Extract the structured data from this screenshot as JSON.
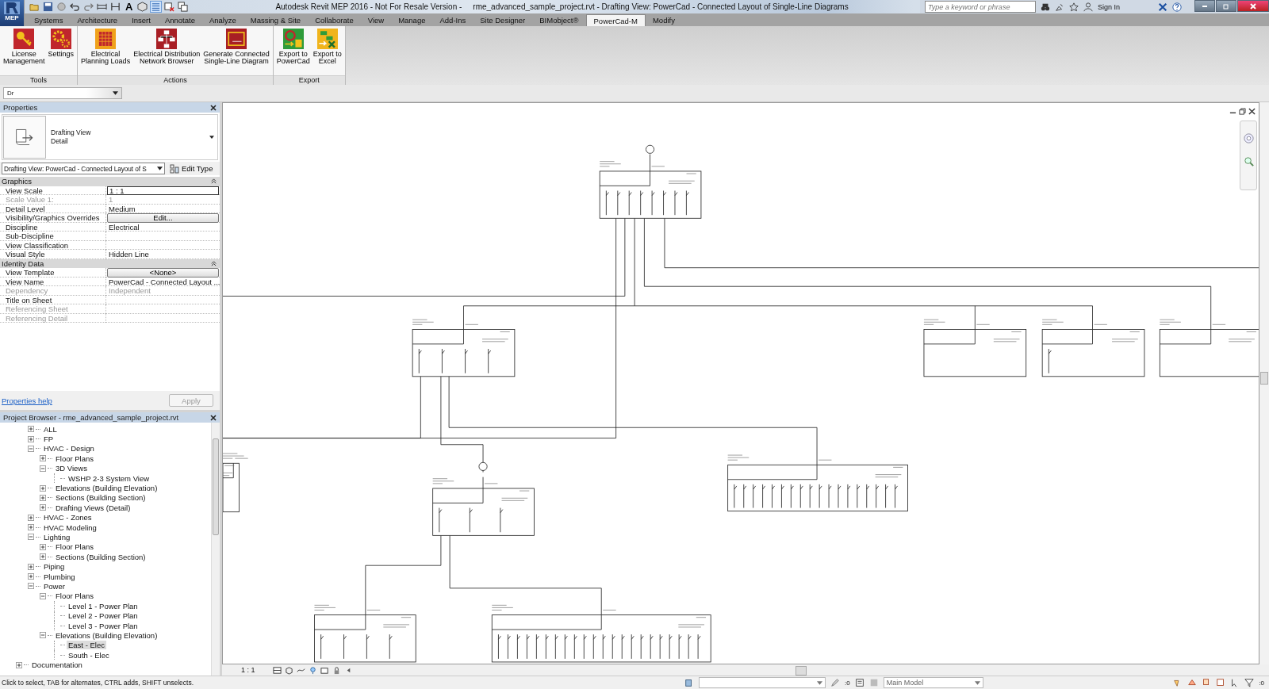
{
  "app_menu_label": "MEP",
  "quick_access": {
    "text_tool": "A"
  },
  "title_bar": {
    "app_title": "Autodesk Revit MEP 2016 - Not For Resale Version -",
    "document_title": "rme_advanced_sample_project.rvt - Drafting View: PowerCad - Connected Layout of Single-Line Diagrams"
  },
  "search": {
    "placeholder": "Type a keyword or phrase"
  },
  "sign_in": "Sign In",
  "ribbon_tabs": [
    {
      "label": "Systems",
      "selected": false
    },
    {
      "label": "Architecture",
      "selected": false
    },
    {
      "label": "Insert",
      "selected": false
    },
    {
      "label": "Annotate",
      "selected": false
    },
    {
      "label": "Analyze",
      "selected": false
    },
    {
      "label": "Massing & Site",
      "selected": false
    },
    {
      "label": "Collaborate",
      "selected": false
    },
    {
      "label": "View",
      "selected": false
    },
    {
      "label": "Manage",
      "selected": false
    },
    {
      "label": "Add-Ins",
      "selected": false
    },
    {
      "label": "Site Designer",
      "selected": false
    },
    {
      "label": "BIMobject®",
      "selected": false
    },
    {
      "label": "PowerCad-M",
      "selected": true
    },
    {
      "label": "Modify",
      "selected": false
    }
  ],
  "ribbon_panels": [
    {
      "title": "Tools",
      "buttons": [
        {
          "lines": [
            "License",
            "Management"
          ],
          "kind": "license"
        },
        {
          "lines": [
            "Settings"
          ],
          "kind": "settings"
        }
      ]
    },
    {
      "title": "Actions",
      "buttons": [
        {
          "lines": [
            "Electrical",
            "Planning Loads"
          ],
          "kind": "table"
        },
        {
          "lines": [
            "Electrical Distribution",
            "Network Browser"
          ],
          "kind": "network"
        },
        {
          "lines": [
            "Generate Connected",
            "Single-Line Diagram"
          ],
          "kind": "diagram"
        }
      ]
    },
    {
      "title": "Export",
      "buttons": [
        {
          "lines": [
            "Export to",
            "PowerCad"
          ],
          "kind": "powercad"
        },
        {
          "lines": [
            "Export to",
            "Excel"
          ],
          "kind": "excel"
        }
      ]
    }
  ],
  "options_bar": {
    "selector": "Dr"
  },
  "properties": {
    "title": "Properties",
    "type_lines": [
      "Drafting View",
      "Detail"
    ],
    "instance_selector": "Drafting View: PowerCad - Connected Layout of S",
    "edit_type": "Edit Type",
    "groups": [
      {
        "name": "Graphics",
        "expanded": true,
        "rows": [
          {
            "name": "View Scale",
            "value": "1 : 1",
            "kind": "field",
            "disabled": false
          },
          {
            "name": "Scale Value    1:",
            "value": "1",
            "kind": "text",
            "disabled": true
          },
          {
            "name": "Detail Level",
            "value": "Medium",
            "kind": "text",
            "disabled": false
          },
          {
            "name": "Visibility/Graphics Overrides",
            "value": "Edit...",
            "kind": "button",
            "disabled": false
          },
          {
            "name": "Discipline",
            "value": "Electrical",
            "kind": "text",
            "disabled": false
          },
          {
            "name": "Sub-Discipline",
            "kind": "text",
            "disabled": false
          },
          {
            "name": "View Classification",
            "kind": "text",
            "disabled": false
          },
          {
            "name": "Visual Style",
            "value": "Hidden Line",
            "kind": "text",
            "disabled": false
          }
        ]
      },
      {
        "name": "Identity Data",
        "expanded": true,
        "rows": [
          {
            "name": "View Template",
            "value": "<None>",
            "kind": "button",
            "disabled": false
          },
          {
            "name": "View Name",
            "value": "PowerCad - Connected Layout ...",
            "kind": "text",
            "disabled": false
          },
          {
            "name": "Dependency",
            "value": "Independent",
            "kind": "text",
            "disabled": true
          },
          {
            "name": "Title on Sheet",
            "kind": "text",
            "disabled": false
          },
          {
            "name": "Referencing Sheet",
            "kind": "text",
            "disabled": true
          },
          {
            "name": "Referencing Detail",
            "kind": "text",
            "disabled": true
          }
        ]
      }
    ],
    "help_link": "Properties help",
    "apply": {
      "label": "Apply",
      "disabled": true
    }
  },
  "project_browser": {
    "title": "Project Browser - rme_advanced_sample_project.rvt",
    "items": [
      {
        "label": "ALL",
        "expanded": false,
        "selected": false
      },
      {
        "label": "FP",
        "expanded": false,
        "selected": false
      },
      {
        "label": "HVAC - Design",
        "expanded": true,
        "selected": false,
        "children": [
          {
            "label": "Floor Plans",
            "expanded": false,
            "selected": false
          },
          {
            "label": "3D Views",
            "expanded": true,
            "selected": false,
            "children": [
              {
                "label": "WSHP 2-3 System View",
                "selected": false
              }
            ]
          },
          {
            "label": "Elevations (Building Elevation)",
            "expanded": false,
            "selected": false
          },
          {
            "label": "Sections (Building Section)",
            "expanded": false,
            "selected": false
          },
          {
            "label": "Drafting Views (Detail)",
            "expanded": false,
            "selected": false
          }
        ]
      },
      {
        "label": "HVAC - Zones",
        "expanded": false,
        "selected": false
      },
      {
        "label": "HVAC Modeling",
        "expanded": false,
        "selected": false
      },
      {
        "label": "Lighting",
        "expanded": true,
        "selected": false,
        "children": [
          {
            "label": "Floor Plans",
            "expanded": false,
            "selected": false
          },
          {
            "label": "Sections (Building Section)",
            "expanded": false,
            "selected": false
          }
        ]
      },
      {
        "label": "Piping",
        "expanded": false,
        "selected": false
      },
      {
        "label": "Plumbing",
        "expanded": false,
        "selected": false
      },
      {
        "label": "Power",
        "expanded": true,
        "selected": false,
        "children": [
          {
            "label": "Floor Plans",
            "expanded": true,
            "selected": false,
            "children": [
              {
                "label": "Level 1 - Power Plan",
                "selected": false
              },
              {
                "label": "Level 2 - Power Plan",
                "selected": false
              },
              {
                "label": "Level 3 - Power Plan",
                "selected": false
              }
            ]
          },
          {
            "label": "Elevations (Building Elevation)",
            "expanded": true,
            "selected": false,
            "children": [
              {
                "label": "East - Elec",
                "selected": true
              },
              {
                "label": "South - Elec",
                "selected": false
              }
            ]
          }
        ]
      }
    ],
    "root_items": [
      {
        "label": "Documentation",
        "expanded": false,
        "selected": false
      }
    ]
  },
  "view_bar": {
    "scale": "1 : 1"
  },
  "status_bar": {
    "message": "Click to select, TAB for alternates, CTRL adds, SHIFT unselects.",
    "editable_count": ":0",
    "workset": "Main Model",
    "filter_count": ":0"
  }
}
